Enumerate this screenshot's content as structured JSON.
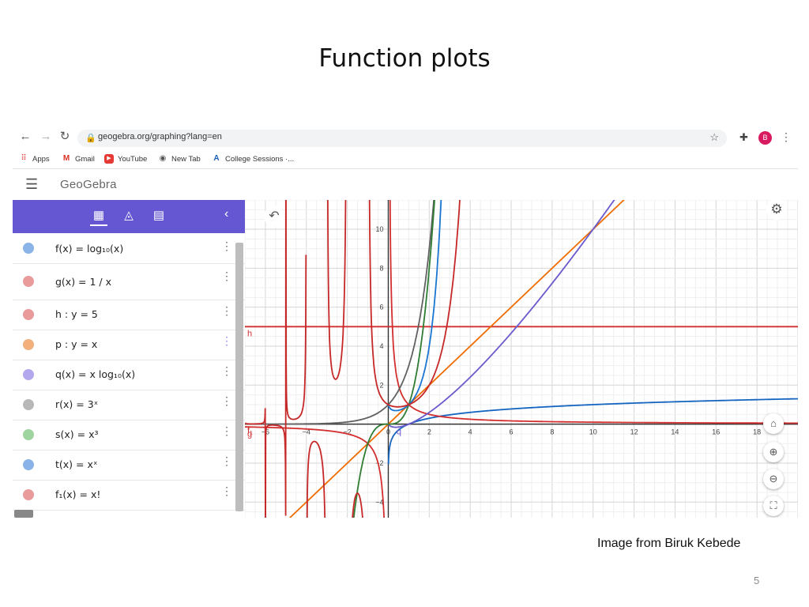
{
  "slide": {
    "title": "Function plots",
    "caption": "Image from Biruk Kebede",
    "page_number": "5"
  },
  "browser": {
    "url": "geogebra.org/graphing?lang=en",
    "profile_initial": "B",
    "bookmarks": [
      {
        "label": "Apps",
        "icon": "apps-grid-icon"
      },
      {
        "label": "Gmail",
        "icon": "gmail-icon"
      },
      {
        "label": "YouTube",
        "icon": "youtube-icon"
      },
      {
        "label": "New Tab",
        "icon": "globe-icon"
      },
      {
        "label": "College Sessions ·...",
        "icon": "college-icon"
      }
    ]
  },
  "app": {
    "logo": "GeoGebra",
    "accent": "#6557d2"
  },
  "algebra": {
    "items": [
      {
        "name": "f",
        "expr": "f(x)  =  log₁₀(x)",
        "color": "#8ab4e8"
      },
      {
        "name": "g",
        "expr": "g(x)  =  1 / x",
        "color": "#e99a9a"
      },
      {
        "name": "h",
        "expr": "h :  y  =  5",
        "color": "#e99a9a"
      },
      {
        "name": "p",
        "expr": "p :  y  =  x",
        "color": "#f3b07a"
      },
      {
        "name": "q",
        "expr": "q(x)  =  x log₁₀(x)",
        "color": "#b3a8ee"
      },
      {
        "name": "r",
        "expr": "r(x)  =  3ˣ",
        "color": "#b8b8b8"
      },
      {
        "name": "s",
        "expr": "s(x)  =  x³",
        "color": "#9fd3a0"
      },
      {
        "name": "t",
        "expr": "t(x)  =  xˣ",
        "color": "#8ab4e8"
      },
      {
        "name": "f1",
        "expr": "f₁(x)  =  x!",
        "color": "#e99a9a"
      }
    ]
  },
  "chart_data": {
    "type": "line",
    "x_ticks": [
      -6,
      -4,
      -2,
      0,
      2,
      4,
      6,
      8,
      10,
      12,
      14,
      16,
      18
    ],
    "y_ticks": [
      -4,
      -2,
      2,
      4,
      6,
      8,
      10
    ],
    "xlim": [
      -7,
      20
    ],
    "ylim": [
      -4.8,
      11.5
    ],
    "grid": true,
    "series": [
      {
        "name": "f",
        "color": "#1565c0",
        "func": "log10"
      },
      {
        "name": "g",
        "color": "#d32f2f",
        "func": "reciprocal"
      },
      {
        "name": "h",
        "color": "#d32f2f",
        "func": "const5"
      },
      {
        "name": "p",
        "color": "#ef6c00",
        "func": "identity"
      },
      {
        "name": "q",
        "color": "#6a5acd",
        "func": "xlog10"
      },
      {
        "name": "r",
        "color": "#616161",
        "func": "pow3"
      },
      {
        "name": "s",
        "color": "#2e7d32",
        "func": "cube"
      },
      {
        "name": "t",
        "color": "#1976d2",
        "func": "xpowx"
      },
      {
        "name": "f1",
        "color": "#c62828",
        "func": "factorial"
      }
    ],
    "labels": {
      "h": "h",
      "f1": "f₁",
      "g": "g",
      "q": "q"
    }
  }
}
